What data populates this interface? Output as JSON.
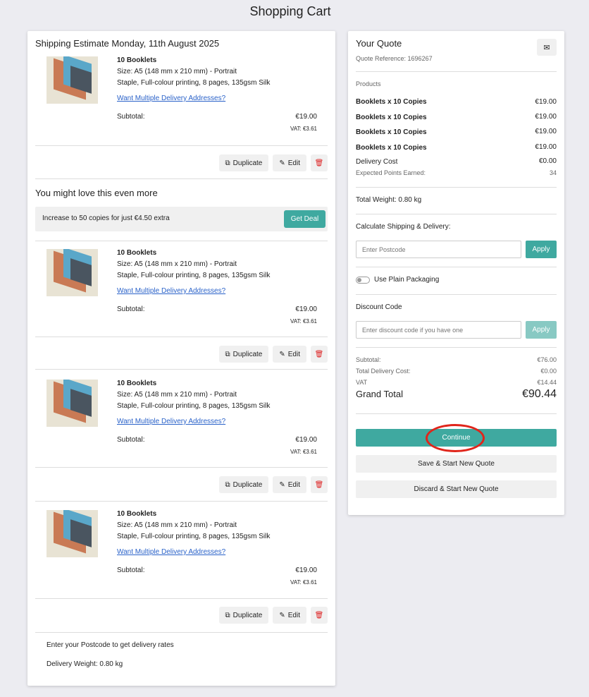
{
  "page": {
    "title": "Shopping Cart"
  },
  "cart": {
    "shipping_estimate": "Shipping Estimate Monday, 11th August 2025",
    "items": [
      {
        "name": "10 Booklets",
        "size": "Size: A5 (148 mm x 210 mm) - Portrait",
        "spec": "Staple, Full-colour printing, 8 pages, 135gsm Silk",
        "link": "Want Multiple Delivery Addresses?",
        "subtotal_label": "Subtotal:",
        "subtotal": "€19.00",
        "vat": "VAT: €3.61"
      },
      {
        "name": "10 Booklets",
        "size": "Size: A5 (148 mm x 210 mm) - Portrait",
        "spec": "Staple, Full-colour printing, 8 pages, 135gsm Silk",
        "link": "Want Multiple Delivery Addresses?",
        "subtotal_label": "Subtotal:",
        "subtotal": "€19.00",
        "vat": "VAT: €3.61"
      },
      {
        "name": "10 Booklets",
        "size": "Size: A5 (148 mm x 210 mm) - Portrait",
        "spec": "Staple, Full-colour printing, 8 pages, 135gsm Silk",
        "link": "Want Multiple Delivery Addresses?",
        "subtotal_label": "Subtotal:",
        "subtotal": "€19.00",
        "vat": "VAT: €3.61"
      },
      {
        "name": "10 Booklets",
        "size": "Size: A5 (148 mm x 210 mm) - Portrait",
        "spec": "Staple, Full-colour printing, 8 pages, 135gsm Silk",
        "link": "Want Multiple Delivery Addresses?",
        "subtotal_label": "Subtotal:",
        "subtotal": "€19.00",
        "vat": "VAT: €3.61"
      }
    ],
    "actions": {
      "duplicate": "Duplicate",
      "edit": "Edit"
    },
    "upsell": {
      "title": "You might love this even more",
      "text": "Increase to 50 copies for just €4.50 extra",
      "button": "Get Deal"
    },
    "footer": {
      "postcode_note": "Enter your Postcode to get delivery rates",
      "weight": "Delivery Weight: 0.80 kg"
    }
  },
  "quote": {
    "title": "Your Quote",
    "reference": "Quote Reference: 1696267",
    "products_label": "Products",
    "products": [
      {
        "name": "Booklets x 10 Copies",
        "price": "€19.00"
      },
      {
        "name": "Booklets x 10 Copies",
        "price": "€19.00"
      },
      {
        "name": "Booklets x 10 Copies",
        "price": "€19.00"
      },
      {
        "name": "Booklets x 10 Copies",
        "price": "€19.00"
      }
    ],
    "delivery_label": "Delivery Cost",
    "delivery_value": "€0.00",
    "points_label": "Expected Points Earned:",
    "points_value": "34",
    "total_weight": "Total Weight: 0.80 kg",
    "shipping_label": "Calculate Shipping & Delivery:",
    "postcode_placeholder": "Enter Postcode",
    "apply": "Apply",
    "plain_packaging": "Use Plain Packaging",
    "discount_label": "Discount Code",
    "discount_placeholder": "Enter discount code if you have one",
    "totals": {
      "subtotal_label": "Subtotal:",
      "subtotal": "€76.00",
      "delivery_label": "Total Delivery Cost:",
      "delivery": "€0.00",
      "vat_label": "VAT",
      "vat": "€14.44",
      "grand_label": "Grand Total",
      "grand": "€90.44"
    },
    "continue": "Continue",
    "save_new": "Save & Start New Quote",
    "discard_new": "Discard & Start New Quote"
  },
  "colors": {
    "accent": "#3fa9a0",
    "highlight": "#e0251b",
    "link": "#2a62c9",
    "delete": "#dd2222"
  },
  "icons": {
    "duplicate": "duplicate-icon",
    "edit": "edit-icon",
    "delete": "trash-icon",
    "mail": "envelope-icon"
  }
}
